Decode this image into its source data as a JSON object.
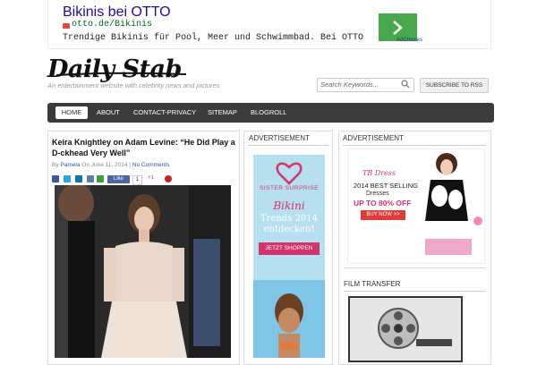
{
  "top_ad": {
    "title": "Bikinis bei OTTO",
    "url": "otto.de/Bikinis",
    "description": "Trendige Bikinis für Pool, Meer und Schwimmbad. Bei OTTO",
    "adchoices": "AdChoices"
  },
  "header": {
    "logo": "Daily Stab",
    "tagline": "An entertainment website with celebrity news and pictures",
    "search_placeholder": "Search Keywords...",
    "rss_label": "SUBSCRIBE TO RSS"
  },
  "nav": {
    "items": [
      "HOME",
      "ABOUT",
      "CONTACT-PRIVACY",
      "SITEMAP",
      "BLOGROLL"
    ]
  },
  "post": {
    "title": "Keira Knightley on Adam Levine: “He Did Play a D-ckhead Very Well”",
    "by": "By",
    "author": "Pamela",
    "on": "On",
    "date": "June 11, 2014",
    "separator": "|",
    "comments": "No Comments",
    "fb_like": "Like",
    "like_count": "1",
    "gplus": "+1"
  },
  "sidebar_mid": {
    "heading": "ADVERTISEMENT",
    "brand": "SISTER SURPRISE",
    "headline": "Bikini",
    "subline": "Trends 2014 entdecken!",
    "cta": "JETZT SHOPPEN"
  },
  "sidebar_right": {
    "heading": "ADVERTISEMENT",
    "brand": "TB Dress",
    "line1": "2014 BEST SELLING",
    "line2": "Dresses",
    "line3": "UP TO 80% OFF",
    "cta": "BUY NOW >>",
    "film_heading": "FILM TRANSFER"
  },
  "colors": {
    "nav_bg": "#3b3b3b",
    "link": "#1e5ea8",
    "ad_green": "#47a94b",
    "accent_pink": "#d6336c"
  }
}
